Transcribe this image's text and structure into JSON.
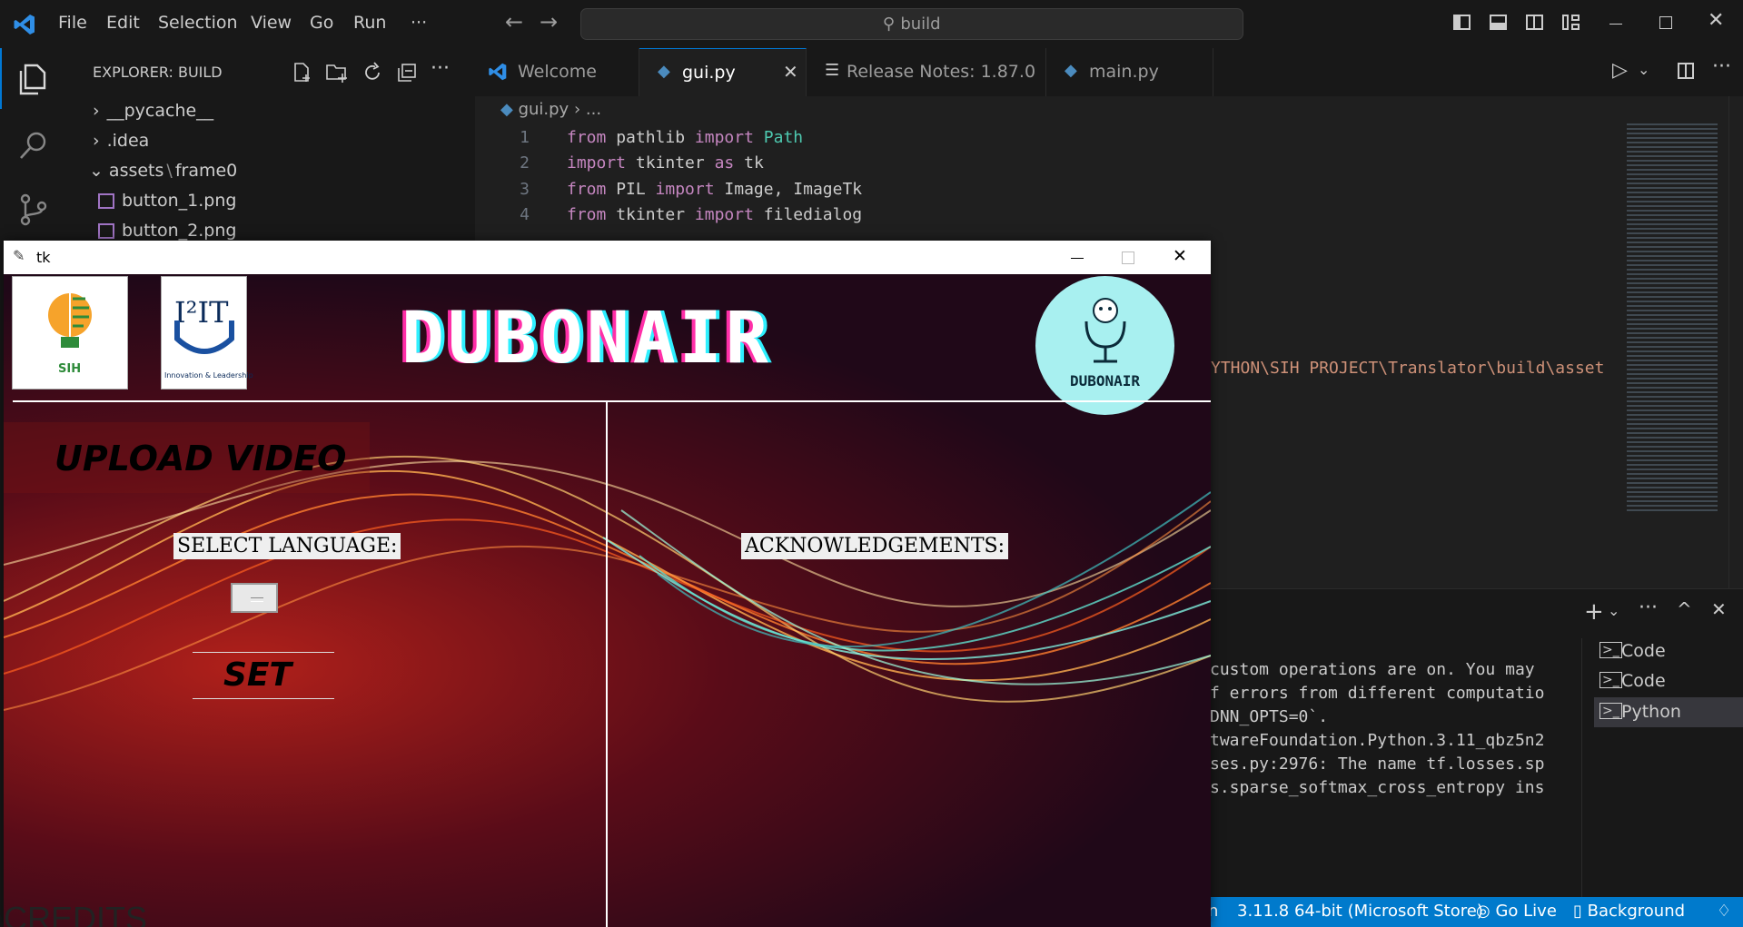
{
  "titlebar": {
    "menu": [
      "File",
      "Edit",
      "Selection",
      "View",
      "Go",
      "Run",
      "···"
    ],
    "search_text": "build"
  },
  "sidebar": {
    "title": "EXPLORER: BUILD",
    "items": [
      {
        "label": "__pycache__",
        "type": "folder-collapsed"
      },
      {
        "label": ".idea",
        "type": "folder-collapsed"
      },
      {
        "label": "assets",
        "sep": "\\",
        "label2": "frame0",
        "type": "folder-open"
      },
      {
        "label": "button_1.png",
        "type": "file"
      },
      {
        "label": "button_2.png",
        "type": "file"
      }
    ]
  },
  "tabs": [
    {
      "label": "Welcome",
      "icon": "vscode-icon",
      "active": false
    },
    {
      "label": "gui.py",
      "icon": "python-icon",
      "active": true
    },
    {
      "label": "Release Notes: 1.87.0",
      "icon": "document-icon",
      "active": false
    },
    {
      "label": "main.py",
      "icon": "python-icon",
      "active": false
    }
  ],
  "editor": {
    "breadcrumb_file": "gui.py",
    "breadcrumb_rest": "...",
    "lines": [
      {
        "num": "1",
        "kw1": "from",
        "mod": " pathlib ",
        "kw2": "import",
        "name": " Path"
      },
      {
        "num": "2",
        "kw1": "import",
        "mod": " tkinter ",
        "kw2": "as",
        "name": " tk"
      },
      {
        "num": "3",
        "kw1": "from",
        "mod": " PIL ",
        "kw2": "import",
        "name": " Image, ImageTk"
      },
      {
        "num": "4",
        "kw1": "from",
        "mod": " tkinter ",
        "kw2": "import",
        "name": " filedialog"
      }
    ],
    "path_fragment": "YTHON\\SIH PROJECT\\Translator\\build\\asset"
  },
  "terminal": {
    "lines": [
      "custom operations are on. You may",
      "f errors from different computatio",
      "DNN_OPTS=0`.",
      "twareFoundation.Python.3.11_qbz5n2",
      "ses.py:2976: The name tf.losses.sp",
      "s.sparse_softmax_cross_entropy ins"
    ],
    "sessions": [
      "Code",
      "Code",
      "Python"
    ]
  },
  "statusbar": {
    "left_fragment": "n",
    "python_version": "3.11.8 64-bit (Microsoft Store)",
    "go_live": "Go Live",
    "background": "Background"
  },
  "tk": {
    "title": "tk",
    "app_title": "DUBONAIR",
    "logo_sih_text": "SIH",
    "logo_i2it_text": "I²IT",
    "logo_i2it_sub": "Innovation & Leadership",
    "logo_dubonair_text": "DUBONAIR",
    "upload_label": "UPLOAD VIDEO",
    "select_language_label": "SELECT LANGUAGE:",
    "set_label": "SET",
    "ack_label": "ACKNOWLEDGEMENTS:",
    "credits_label": "CREDITS"
  }
}
